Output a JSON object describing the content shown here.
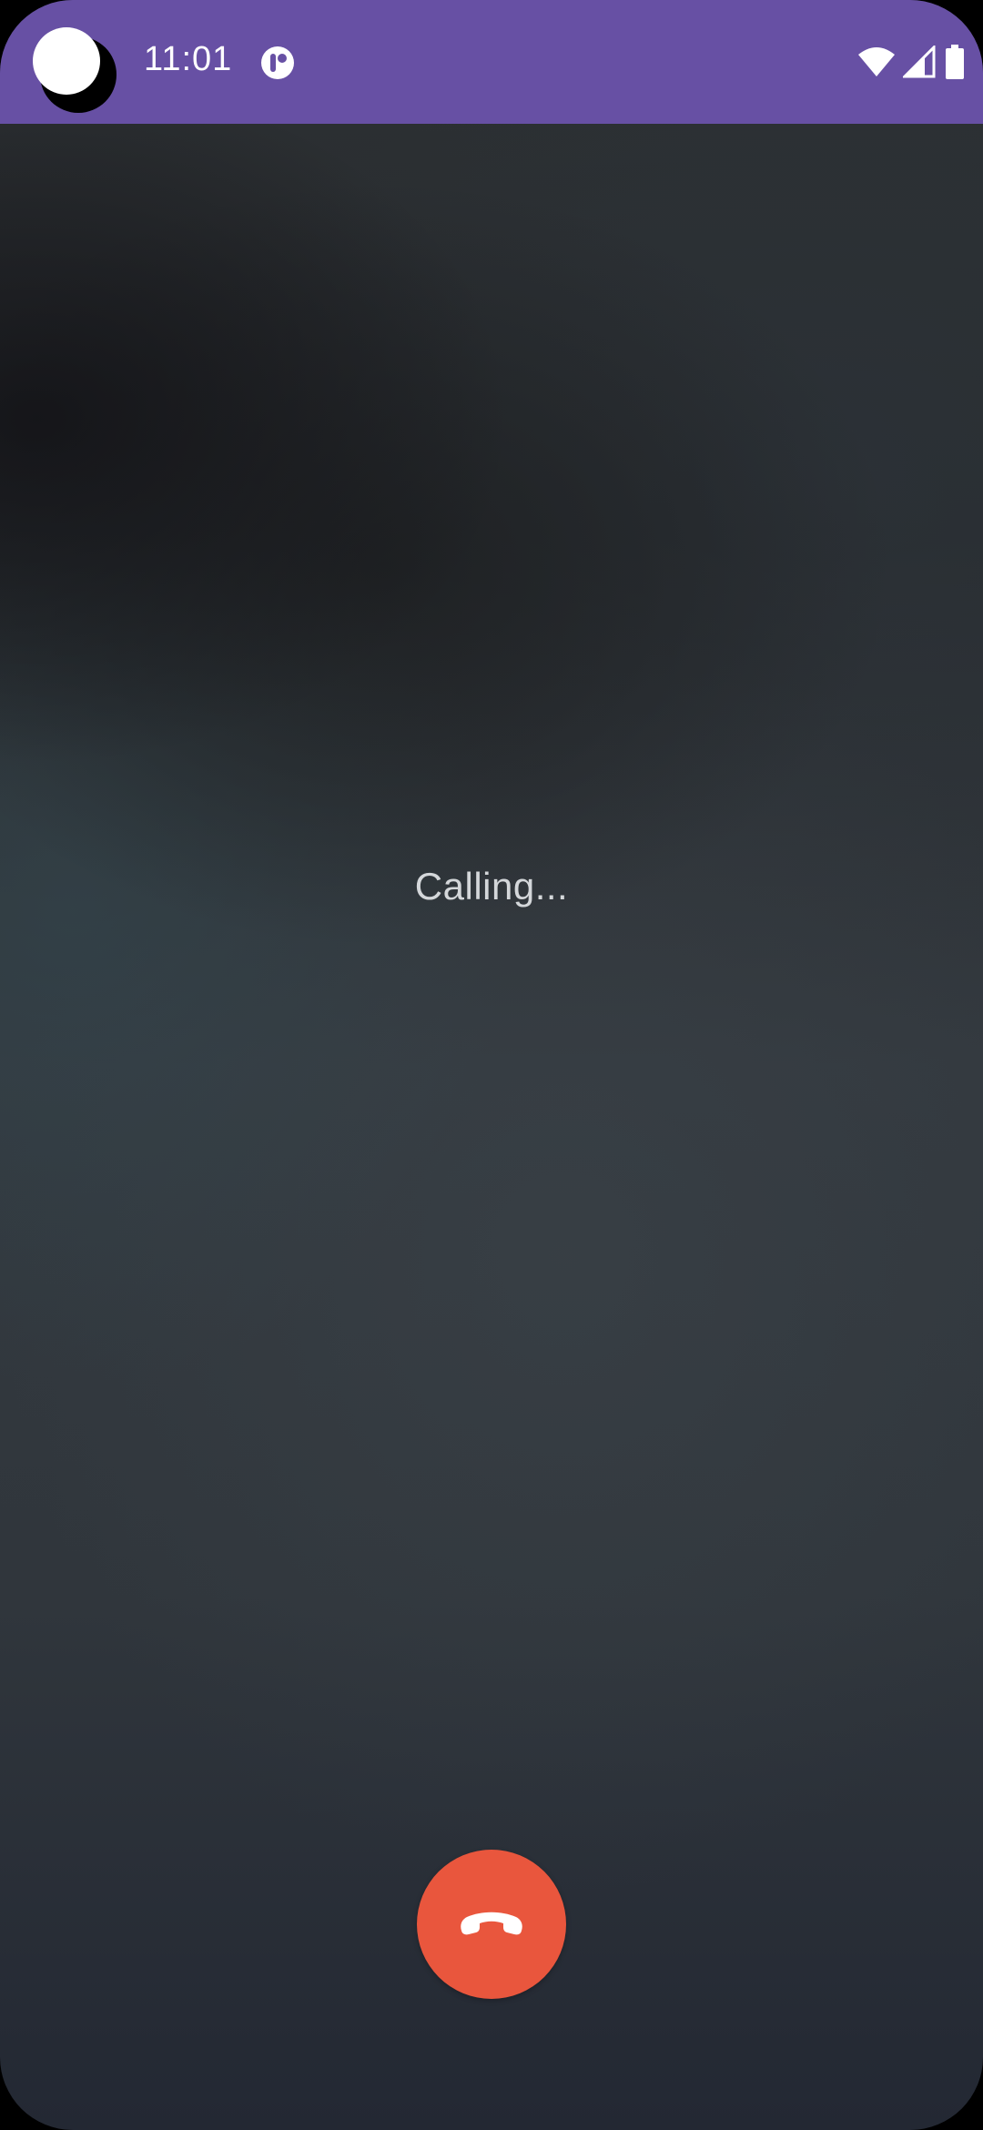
{
  "status_bar": {
    "time": "11:01",
    "background_color": "#6750a4",
    "icons": [
      "notification-app-icon",
      "wifi-icon",
      "cellular-signal-icon",
      "battery-icon"
    ]
  },
  "call": {
    "status_text": "Calling...",
    "end_call_icon": "phone-hangup-icon",
    "end_call_color": "#e9563d"
  }
}
